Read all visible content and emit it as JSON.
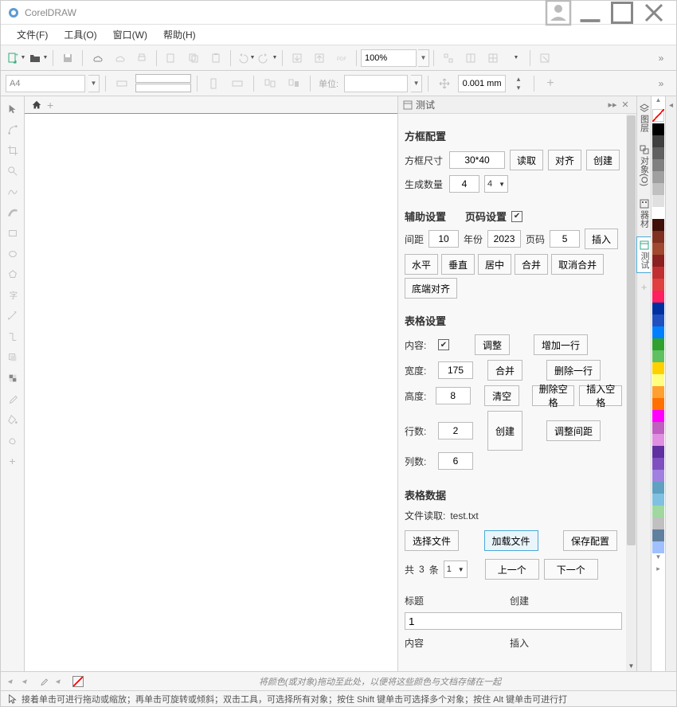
{
  "app": {
    "title": "CorelDRAW"
  },
  "menubar": {
    "file": "文件(F)",
    "tools": "工具(O)",
    "window": "窗口(W)",
    "help": "帮助(H)"
  },
  "toolbar": {
    "zoom": "100%",
    "page": "A4",
    "units_label": "单位:",
    "nudge": "0.001 mm"
  },
  "docker": {
    "title": "测试",
    "sec_box": "方框配置",
    "box_size_label": "方框尺寸",
    "box_size": "30*40",
    "gen_count_label": "生成数量",
    "gen_count": "4",
    "gen_count_dd": "4",
    "read": "读取",
    "align": "对齐",
    "create": "创建",
    "sec_aux": "辅助设置",
    "sec_page": "页码设置",
    "gap_label": "间距",
    "gap": "10",
    "year_label": "年份",
    "year": "2023",
    "pageno_label": "页码",
    "pageno": "5",
    "insert": "插入",
    "horiz": "水平",
    "vert": "垂直",
    "center": "居中",
    "merge": "合并",
    "unmerge": "取消合并",
    "bottom_align": "底端对齐",
    "sec_table": "表格设置",
    "content_label": "内容:",
    "adjust": "调整",
    "add_row": "增加一行",
    "width_label": "宽度:",
    "width": "175",
    "merge2": "合并",
    "del_row": "删除一行",
    "height_label": "高度:",
    "height": "8",
    "clear": "清空",
    "del_space": "删除空格",
    "ins_space": "插入空格",
    "rows_label": "行数:",
    "rows": "2",
    "create2": "创建",
    "adjust_gap": "调整间距",
    "cols_label": "列数:",
    "cols": "6",
    "sec_data": "表格数据",
    "file_read_label": "文件读取:",
    "file_name": "test.txt",
    "choose_file": "选择文件",
    "load_file": "加载文件",
    "save_cfg": "保存配置",
    "total_prefix": "共",
    "total_suffix": "条",
    "total_dd": "1",
    "prev": "上一个",
    "next": "下一个",
    "title_label": "标题",
    "create3": "创建",
    "title_val": "1",
    "content2_label": "内容",
    "insert2": "插入"
  },
  "right_tabs": {
    "layers": "图层",
    "objects": "对象(O)",
    "styles": "器材",
    "test": "测试"
  },
  "bottom": {
    "hint": "将颜色(或对象)拖动至此处，以便将这些颜色与文档存储在一起"
  },
  "status": {
    "text": "接着单击可进行拖动或缩放；再单击可旋转或倾斜；双击工具，可选择所有对象；按住 Shift 键单击可选择多个对象；按住 Alt 键单击可进行打"
  },
  "palette": [
    "#000000",
    "#404040",
    "#606060",
    "#808080",
    "#a0a0a0",
    "#c0c0c0",
    "#e0e0e0",
    "#ffffff",
    "#401008",
    "#803020",
    "#a04830",
    "#8b2020",
    "#c03030",
    "#e04040",
    "#ff2060",
    "#0030a0",
    "#2050c0",
    "#0080ff",
    "#30a030",
    "#60c060",
    "#ffd000",
    "#ffff80",
    "#ffa030",
    "#ff7000",
    "#ff00ff",
    "#c060c0",
    "#e090e0",
    "#6030a0",
    "#8050c0",
    "#a080e0",
    "#60a0c0",
    "#80c0e0",
    "#a0d8a0",
    "#c0c0c0",
    "#6080a0",
    "#a0c0ff"
  ]
}
